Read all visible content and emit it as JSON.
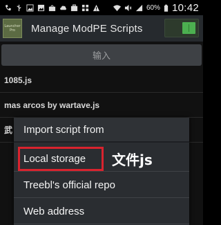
{
  "status_bar": {
    "left_icons": [
      "phone-mute-icon",
      "usb-icon",
      "image-icon",
      "photo-icon",
      "bag-icon",
      "cloud-icon",
      "briefcase-icon",
      "grid-icon",
      "warning-icon"
    ],
    "battery_percent": "60%",
    "time": "10:42"
  },
  "app_bar": {
    "icon_label_1": "Launcher",
    "icon_label_2": "Pro",
    "title": "Manage ModPE Scripts",
    "toggle_on": true,
    "toggle_color": "#4caf50"
  },
  "main": {
    "import_button_label": "输入",
    "scripts": [
      {
        "name": "1085.js"
      },
      {
        "name": "mas arcos by wartave.js"
      },
      {
        "name": "武"
      }
    ]
  },
  "dialog": {
    "title": "Import script from",
    "options": [
      {
        "label": "Local storage"
      },
      {
        "label": "Treebl's official repo"
      },
      {
        "label": "Web address"
      }
    ]
  },
  "annotation": {
    "text": "文件js",
    "highlight_color": "#d9232e"
  }
}
